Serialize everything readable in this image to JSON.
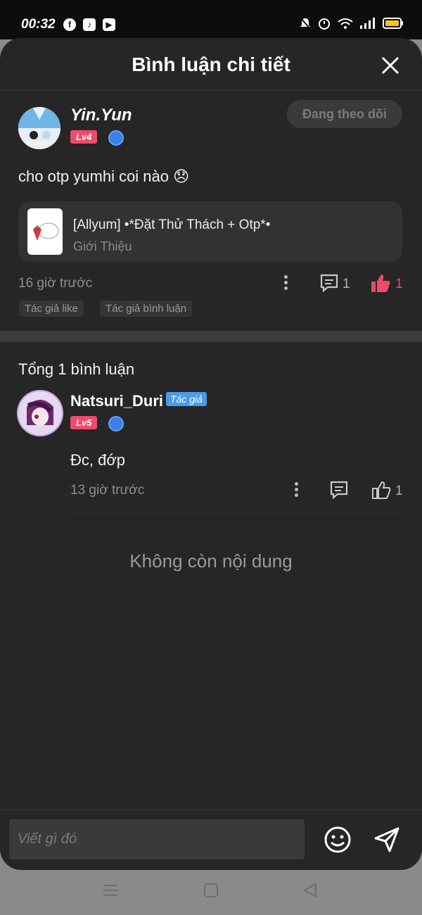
{
  "status_bar": {
    "time": "00:32",
    "apps": [
      "facebook-icon",
      "tiktok-icon",
      "app-icon"
    ]
  },
  "header": {
    "title": "Bình luận chi tiết"
  },
  "post": {
    "author": "Yin.Yun",
    "level": "Lv4",
    "follow_label": "Đang theo dõi",
    "content": "cho otp yumhi coi nào 😞",
    "card": {
      "title": "[Allyum] •*Đặt Thử Thách + Otp*•",
      "subtitle": "Giới Thiệu"
    },
    "time": "16 giờ trước",
    "comment_count": "1",
    "like_count": "1",
    "tags": [
      "Tác giả like",
      "Tác giả bình luận"
    ]
  },
  "comments_section": {
    "total_label": "Tổng 1 bình luận",
    "comments": [
      {
        "author": "Natsuri_Duri",
        "badge": "Tác giả",
        "level": "Lv5",
        "content": "Đc, đớp",
        "time": "13 giờ trước",
        "like_count": "1"
      }
    ],
    "empty_label": "Không còn nội dung"
  },
  "composer": {
    "placeholder": "Viết gì đó"
  },
  "colors": {
    "accent": "#f04a6a",
    "badge_blue": "#4a9bea",
    "background": "#262626"
  }
}
